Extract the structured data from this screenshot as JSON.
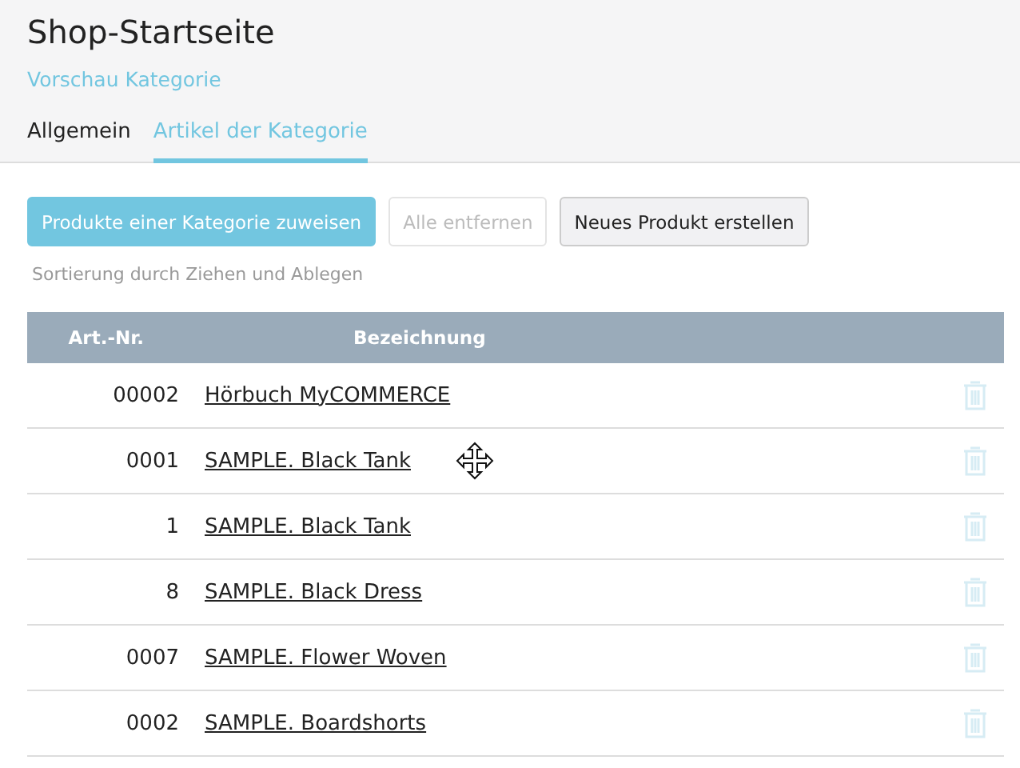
{
  "page": {
    "title": "Shop-Startseite",
    "preview_link": "Vorschau Kategorie"
  },
  "tabs": [
    {
      "label": "Allgemein",
      "selected": false
    },
    {
      "label": "Artikel der Kategorie",
      "selected": true
    }
  ],
  "buttons": [
    {
      "label": "Produkte einer Kategorie zuweisen",
      "kind": "primary",
      "disabled": false
    },
    {
      "label": "Alle entfernen",
      "kind": "default",
      "disabled": true
    },
    {
      "label": "Neues Produkt erstellen",
      "kind": "default",
      "disabled": false
    }
  ],
  "hint": "Sortierung durch Ziehen und Ablegen",
  "table": {
    "columns": [
      "Art.-Nr.",
      "Bezeichnung"
    ],
    "rows": [
      {
        "number": "00002",
        "name": "Hörbuch MyCOMMERCE"
      },
      {
        "number": "0001",
        "name": "SAMPLE. Black Tank"
      },
      {
        "number": "1",
        "name": "SAMPLE. Black Tank"
      },
      {
        "number": "8",
        "name": "SAMPLE. Black Dress"
      },
      {
        "number": "0007",
        "name": "SAMPLE. Flower Woven"
      },
      {
        "number": "0002",
        "name": "SAMPLE. Boardshorts"
      }
    ]
  }
}
